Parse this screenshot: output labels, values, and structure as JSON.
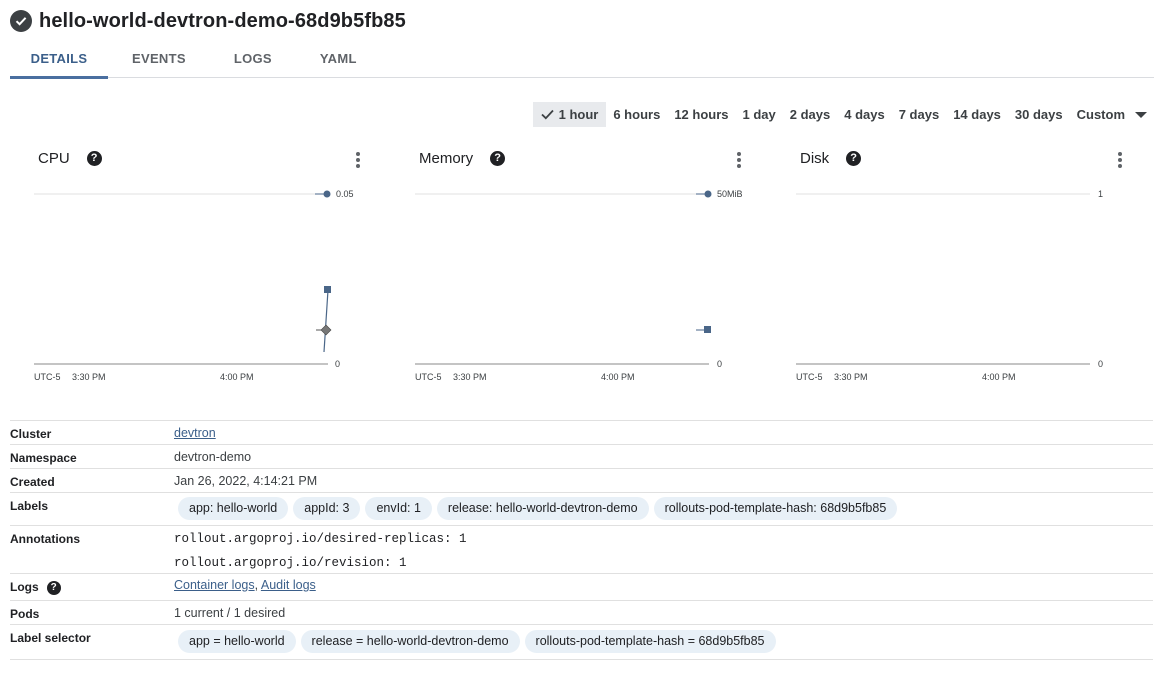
{
  "header": {
    "title": "hello-world-devtron-demo-68d9b5fb85",
    "status_icon": "check-circle-icon"
  },
  "tabs": [
    {
      "label": "DETAILS",
      "active": true
    },
    {
      "label": "EVENTS"
    },
    {
      "label": "LOGS"
    },
    {
      "label": "YAML"
    }
  ],
  "time_range": {
    "selected": "1 hour",
    "options": [
      "1 hour",
      "6 hours",
      "12 hours",
      "1 day",
      "2 days",
      "4 days",
      "7 days",
      "14 days",
      "30 days",
      "Custom"
    ]
  },
  "charts": [
    {
      "title": "CPU",
      "y_max_label": "0.05",
      "y_min_label": "0",
      "x_labels": [
        "UTC-5",
        "3:30 PM",
        "4:00 PM"
      ]
    },
    {
      "title": "Memory",
      "y_max_label": "50MiB",
      "y_min_label": "0",
      "x_labels": [
        "UTC-5",
        "3:30 PM",
        "4:00 PM"
      ]
    },
    {
      "title": "Disk",
      "y_max_label": "1",
      "y_min_label": "0",
      "x_labels": [
        "UTC-5",
        "3:30 PM",
        "4:00 PM"
      ]
    }
  ],
  "details": {
    "cluster_label": "Cluster",
    "cluster_value": "devtron",
    "namespace_label": "Namespace",
    "namespace_value": "devtron-demo",
    "created_label": "Created",
    "created_value": "Jan 26, 2022, 4:14:21 PM",
    "labels_label": "Labels",
    "labels": [
      "app: hello-world",
      "appId: 3",
      "envId: 1",
      "release: hello-world-devtron-demo",
      "rollouts-pod-template-hash: 68d9b5fb85"
    ],
    "annotations_label": "Annotations",
    "annotations": [
      "rollout.argoproj.io/desired-replicas: 1",
      "rollout.argoproj.io/revision: 1"
    ],
    "logs_label": "Logs",
    "container_logs": "Container logs",
    "audit_logs": "Audit logs",
    "pods_label": "Pods",
    "pods_value": "1 current / 1 desired",
    "label_selector_label": "Label selector",
    "label_selector": [
      "app = hello-world",
      "release = hello-world-devtron-demo",
      "rollouts-pod-template-hash = 68d9b5fb85"
    ]
  },
  "colors": {
    "accent": "#3b5f8a",
    "chip_bg": "#e8f0f7",
    "chart_line": "#4a6688"
  }
}
